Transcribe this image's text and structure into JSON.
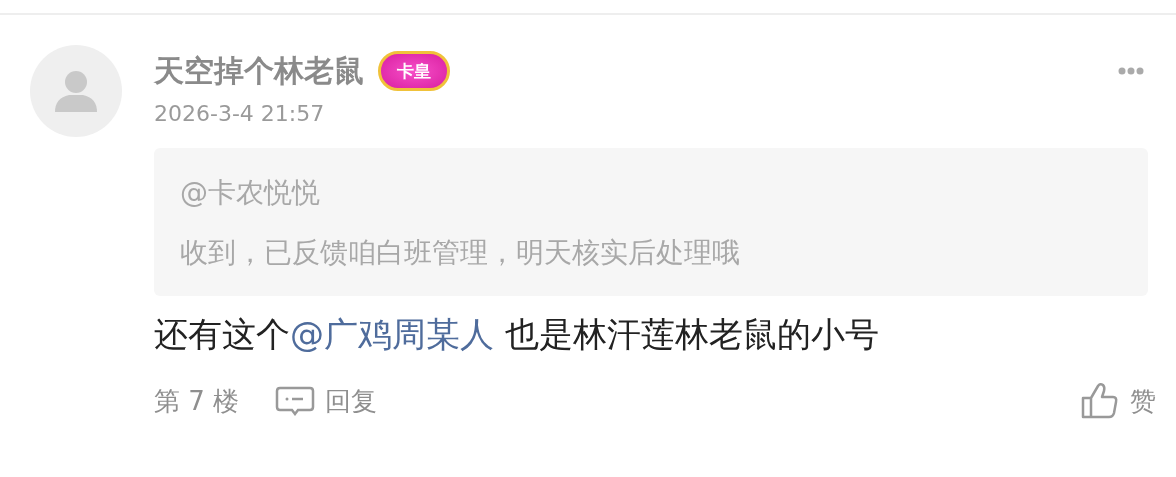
{
  "comment": {
    "username": "天空掉个林老鼠",
    "badge": "卡皇",
    "time": "2026-3-4 21:57",
    "quote": {
      "mention": "@卡农悦悦",
      "text": "收到，已反馈咱白班管理，明天核实后处理哦"
    },
    "content": [
      {
        "kind": "text",
        "text": "还有这个"
      },
      {
        "kind": "mention",
        "text": "@广鸡周某人"
      },
      {
        "kind": "text",
        "text": " 也是林汗莲林老鼠的小号"
      }
    ],
    "floor": "第 7 楼",
    "reply_label": "回复",
    "like_label": "赞"
  }
}
